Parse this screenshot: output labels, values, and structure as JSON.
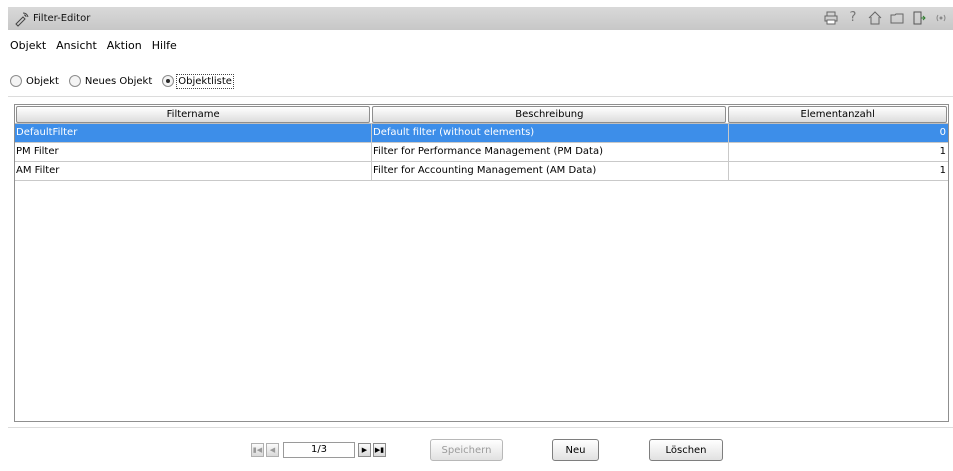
{
  "window": {
    "title": "Filter-Editor",
    "tool_icons": [
      "printer-icon",
      "help-icon",
      "home-icon",
      "folder-icon",
      "export-icon",
      "broadcast-icon"
    ]
  },
  "menu": [
    "Objekt",
    "Ansicht",
    "Aktion",
    "Hilfe"
  ],
  "view_mode": {
    "options": [
      "Objekt",
      "Neues Objekt",
      "Objektliste"
    ],
    "selected": "Objektliste"
  },
  "table": {
    "columns": [
      "Filtername",
      "Beschreibung",
      "Elementanzahl"
    ],
    "rows": [
      {
        "name": "DefaultFilter",
        "description": "Default filter (without elements)",
        "count": "0",
        "selected": true
      },
      {
        "name": "PM Filter",
        "description": "Filter for Performance Management (PM Data)",
        "count": "1",
        "selected": false
      },
      {
        "name": "AM Filter",
        "description": "Filter for Accounting Management (AM Data)",
        "count": "1",
        "selected": false
      }
    ]
  },
  "pagination": {
    "page": "1/3"
  },
  "buttons": {
    "save": "Speichern",
    "new": "Neu",
    "delete": "Löschen"
  },
  "colors": {
    "selection": "#3d8ee9",
    "titlebar": "#cfcfcf"
  }
}
